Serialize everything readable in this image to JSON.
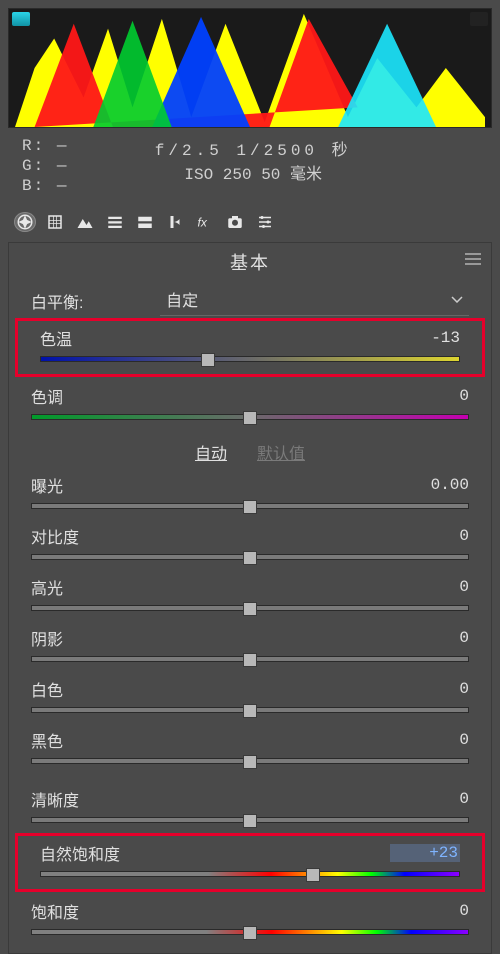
{
  "histogram_clips": {
    "left": true,
    "right": false
  },
  "rgb_readout": {
    "R": "—",
    "G": "—",
    "B": "—"
  },
  "camera_info": {
    "line1": "f/2.5  1/2500 秒",
    "line2": "ISO 250  50 毫米"
  },
  "panel_title": "基本",
  "white_balance": {
    "label": "白平衡:",
    "value": "自定"
  },
  "auto_row": {
    "auto": "自动",
    "default": "默认值"
  },
  "sliders": {
    "temperature": {
      "label": "色温",
      "value": "-13",
      "percent": 40
    },
    "tint": {
      "label": "色调",
      "value": "0",
      "percent": 50
    },
    "exposure": {
      "label": "曝光",
      "value": "0.00",
      "percent": 50
    },
    "contrast": {
      "label": "对比度",
      "value": "0",
      "percent": 50
    },
    "highlights": {
      "label": "高光",
      "value": "0",
      "percent": 50
    },
    "shadows": {
      "label": "阴影",
      "value": "0",
      "percent": 50
    },
    "whites": {
      "label": "白色",
      "value": "0",
      "percent": 50
    },
    "blacks": {
      "label": "黑色",
      "value": "0",
      "percent": 50
    },
    "clarity": {
      "label": "清晰度",
      "value": "0",
      "percent": 50
    },
    "vibrance": {
      "label": "自然饱和度",
      "value": "+23",
      "percent": 65
    },
    "saturation": {
      "label": "饱和度",
      "value": "0",
      "percent": 50
    }
  }
}
